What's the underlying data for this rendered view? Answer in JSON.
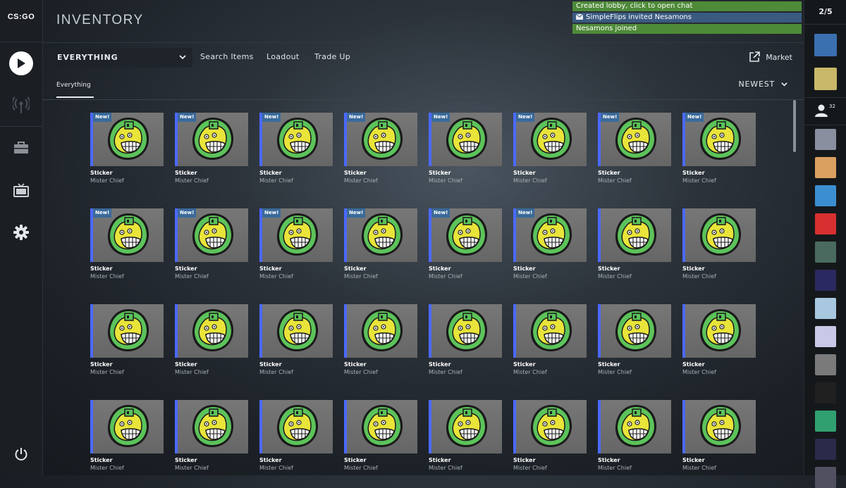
{
  "app": {
    "logo_text": "CS:GO"
  },
  "header": {
    "title": "INVENTORY"
  },
  "notifications": [
    {
      "text": "Created lobby, click to open chat",
      "color": "#4e8a38"
    },
    {
      "text": "SimpleFlips invited Nesamons",
      "color": "#3a5a80",
      "icon": "envelope-icon"
    },
    {
      "text": "Nesamons joined",
      "color": "#4e8a38"
    }
  ],
  "left_nav": {
    "icons": [
      "play-icon",
      "broadcast-icon",
      "briefcase-icon",
      "tv-icon",
      "gear-icon",
      "power-icon"
    ]
  },
  "toolbar": {
    "filter_value": "EVERYTHING",
    "search_label": "Search Items",
    "loadout_label": "Loadout",
    "tradeup_label": "Trade Up",
    "market_label": "Market",
    "tab_everything": "Everything",
    "sort_label": "NEWEST"
  },
  "colors": {
    "rarity": "#4b69ff",
    "new_tag": "#3a6a9a",
    "sticker_green": "#5cc35a",
    "sticker_yellow": "#e8e43a"
  },
  "inventory": {
    "new_tag": "New!",
    "items": [
      {
        "type": "Sticker",
        "name": "Mister Chief",
        "new": true
      },
      {
        "type": "Sticker",
        "name": "Mister Chief",
        "new": true
      },
      {
        "type": "Sticker",
        "name": "Mister Chief",
        "new": true
      },
      {
        "type": "Sticker",
        "name": "Mister Chief",
        "new": true
      },
      {
        "type": "Sticker",
        "name": "Mister Chief",
        "new": true
      },
      {
        "type": "Sticker",
        "name": "Mister Chief",
        "new": true
      },
      {
        "type": "Sticker",
        "name": "Mister Chief",
        "new": true
      },
      {
        "type": "Sticker",
        "name": "Mister Chief",
        "new": true
      },
      {
        "type": "Sticker",
        "name": "Mister Chief",
        "new": true
      },
      {
        "type": "Sticker",
        "name": "Mister Chief",
        "new": true
      },
      {
        "type": "Sticker",
        "name": "Mister Chief",
        "new": true
      },
      {
        "type": "Sticker",
        "name": "Mister Chief",
        "new": true
      },
      {
        "type": "Sticker",
        "name": "Mister Chief",
        "new": true
      },
      {
        "type": "Sticker",
        "name": "Mister Chief",
        "new": true
      },
      {
        "type": "Sticker",
        "name": "Mister Chief",
        "new": false
      },
      {
        "type": "Sticker",
        "name": "Mister Chief",
        "new": false
      },
      {
        "type": "Sticker",
        "name": "Mister Chief",
        "new": false
      },
      {
        "type": "Sticker",
        "name": "Mister Chief",
        "new": false
      },
      {
        "type": "Sticker",
        "name": "Mister Chief",
        "new": false
      },
      {
        "type": "Sticker",
        "name": "Mister Chief",
        "new": false
      },
      {
        "type": "Sticker",
        "name": "Mister Chief",
        "new": false
      },
      {
        "type": "Sticker",
        "name": "Mister Chief",
        "new": false
      },
      {
        "type": "Sticker",
        "name": "Mister Chief",
        "new": false
      },
      {
        "type": "Sticker",
        "name": "Mister Chief",
        "new": false
      },
      {
        "type": "Sticker",
        "name": "Mister Chief",
        "new": false
      },
      {
        "type": "Sticker",
        "name": "Mister Chief",
        "new": false
      },
      {
        "type": "Sticker",
        "name": "Mister Chief",
        "new": false
      },
      {
        "type": "Sticker",
        "name": "Mister Chief",
        "new": false
      },
      {
        "type": "Sticker",
        "name": "Mister Chief",
        "new": false
      },
      {
        "type": "Sticker",
        "name": "Mister Chief",
        "new": false
      },
      {
        "type": "Sticker",
        "name": "Mister Chief",
        "new": false
      },
      {
        "type": "Sticker",
        "name": "Mister Chief",
        "new": false
      }
    ]
  },
  "right_panel": {
    "party_count": "2/5",
    "friends_count": "32",
    "party_avatars": [
      "#3a6fb0",
      "#c8b868"
    ],
    "friend_avatars": [
      "#8a8fa0",
      "#d9a060",
      "#3b8fd0",
      "#d83030",
      "#4a6a60",
      "#2a2a60",
      "#a8c8e0",
      "#c8c8e8",
      "#7a7a7a",
      "#202020",
      "#30a070",
      "#2a2a4a",
      "#505060"
    ]
  }
}
